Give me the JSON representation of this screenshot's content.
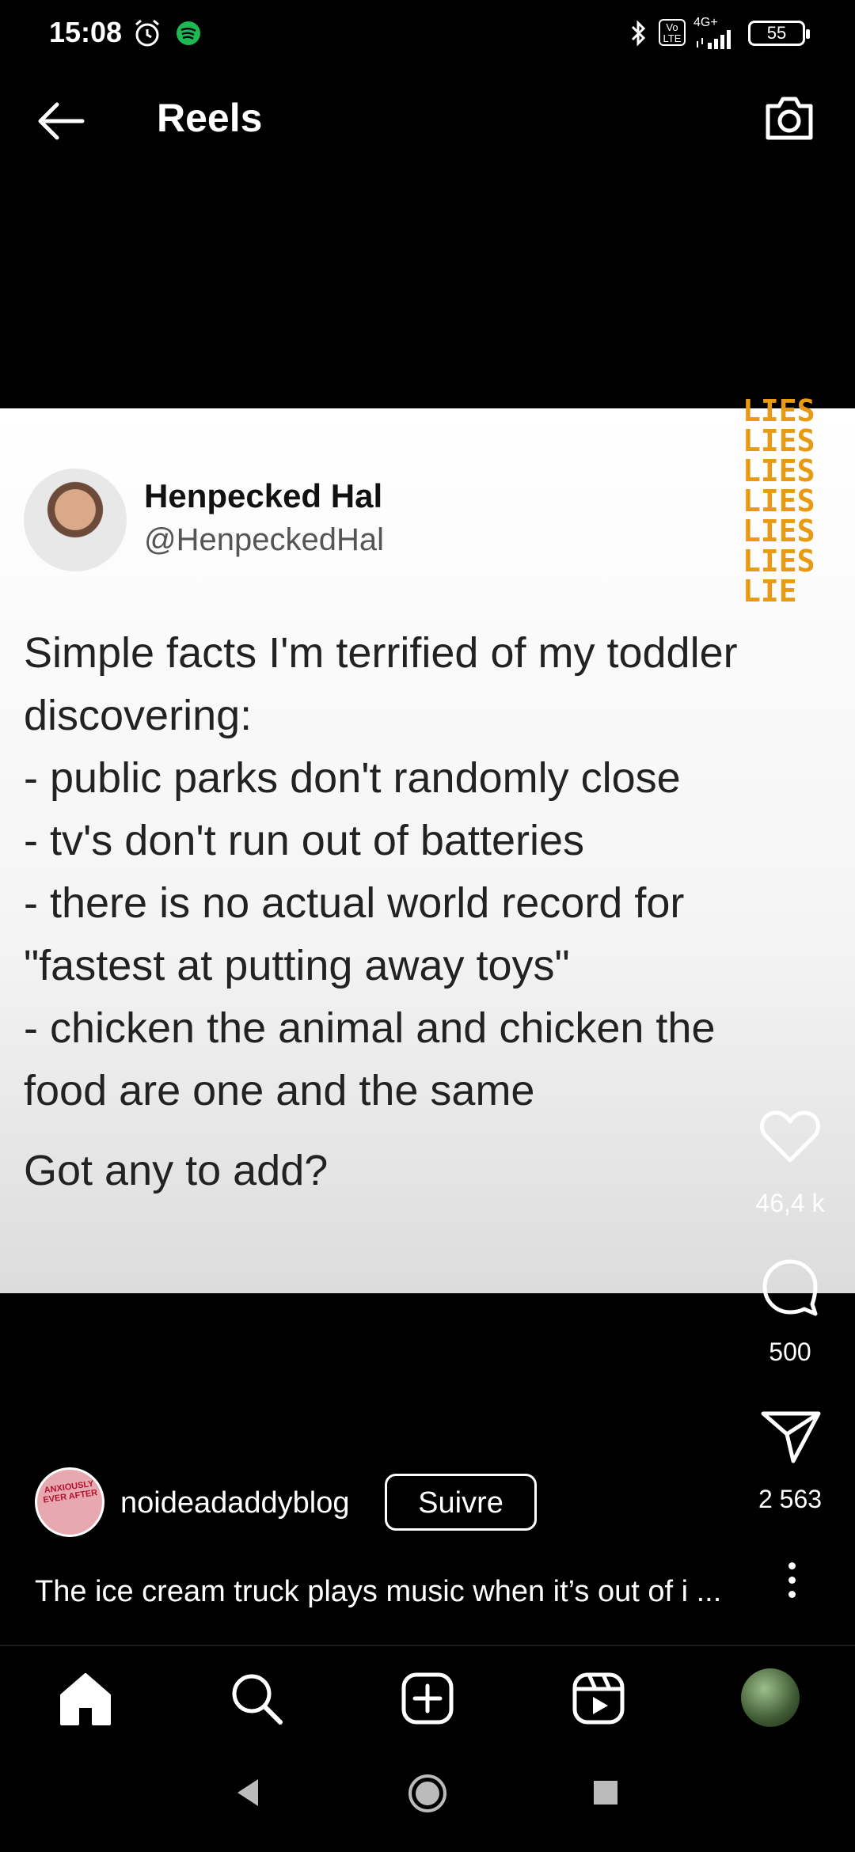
{
  "status_bar": {
    "time": "15:08",
    "network": "4G+",
    "volte": "Vo LTE",
    "battery": "55"
  },
  "header": {
    "title": "Reels"
  },
  "post": {
    "author_name": "Henpecked Hal",
    "author_handle": "@HenpeckedHal",
    "overlay_words": [
      "LIES",
      "LIES",
      "LIES",
      "LIES",
      "LIES",
      "LIES",
      "LIE"
    ],
    "tweet_lines": [
      "Simple facts I'm terrified of my toddler",
      "discovering:",
      "- public parks don't randomly close",
      "- tv's don't run out of batteries",
      "- there is no actual world record for",
      "\"fastest at putting away toys\"",
      "- chicken the animal and chicken the",
      "food are one and the same"
    ],
    "question": "Got any to add?"
  },
  "actions": {
    "likes": "46,4 k",
    "comments": "500",
    "shares": "2 563"
  },
  "author": {
    "username": "noideadaddyblog",
    "follow_label": "Suivre",
    "avatar_text": "ANXIOUSLY EVER AFTER"
  },
  "caption": "The ice cream truck plays music when it’s out of i ...",
  "icons": {
    "back": "arrow-left-icon",
    "camera": "camera-icon",
    "like": "heart-icon",
    "comment": "comment-icon",
    "share": "paper-plane-icon",
    "more": "more-vertical-icon",
    "nav": [
      "home-icon",
      "search-icon",
      "create-icon",
      "reels-icon",
      "profile-avatar"
    ],
    "system": [
      "back-triangle-icon",
      "home-circle-icon",
      "recents-square-icon"
    ]
  },
  "colors": {
    "background": "#000000",
    "overlay_text": "#e79a12",
    "spotify_green": "#1db954"
  }
}
